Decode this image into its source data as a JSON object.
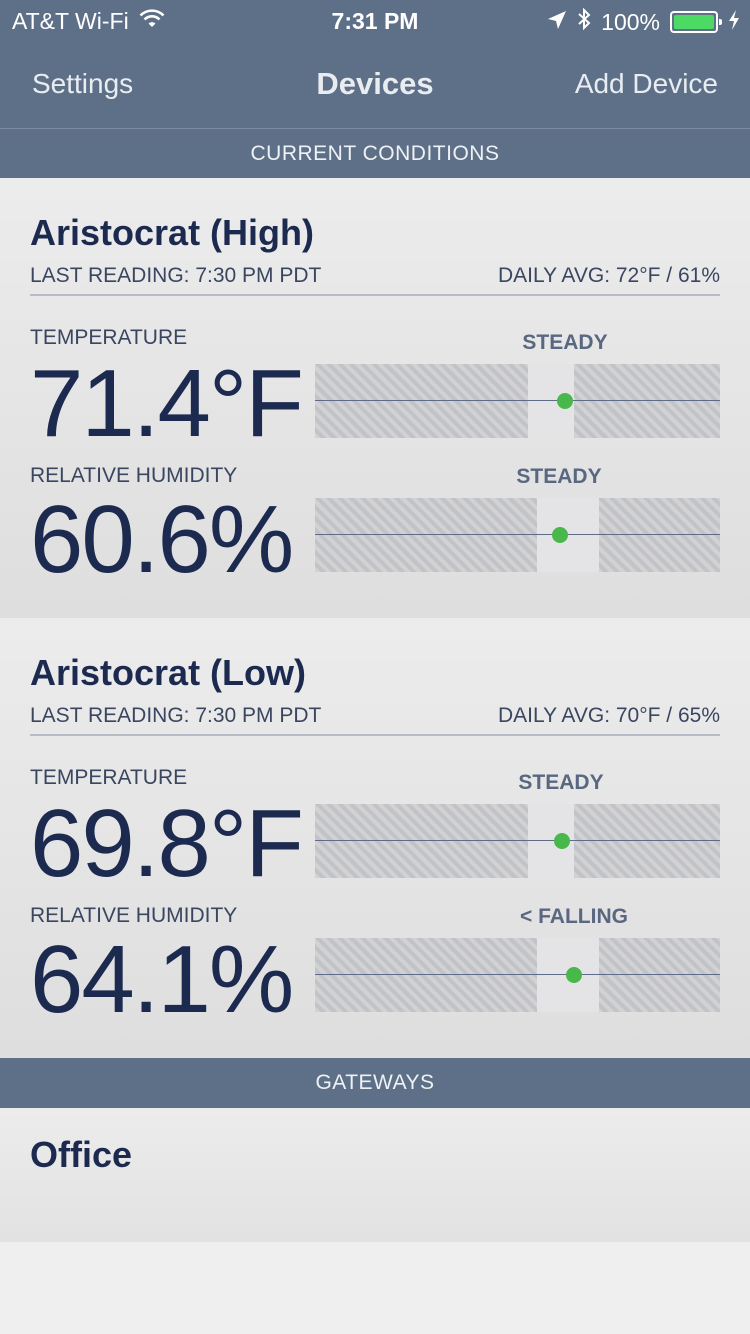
{
  "status_bar": {
    "carrier": "AT&T Wi-Fi",
    "time": "7:31 PM",
    "battery": "100%",
    "wifi_icon": "wifi-icon",
    "location_icon": "location-arrow-icon",
    "bluetooth_icon": "bluetooth-icon",
    "charging_icon": "bolt-icon"
  },
  "nav": {
    "left": "Settings",
    "title": "Devices",
    "right": "Add Device"
  },
  "sections": {
    "current": "CURRENT CONDITIONS",
    "gateways": "GATEWAYS"
  },
  "devices": [
    {
      "name": "Aristocrat (High)",
      "last_reading": "LAST READING: 7:30 PM PDT",
      "daily_avg": "DAILY AVG: 72°F / 61%",
      "temperature": {
        "label": "TEMPERATURE",
        "value": "71.4°F",
        "trend": "STEADY"
      },
      "humidity": {
        "label": "RELATIVE HUMIDITY",
        "value": "60.6%",
        "trend": "STEADY"
      }
    },
    {
      "name": "Aristocrat (Low)",
      "last_reading": "LAST READING: 7:30 PM PDT",
      "daily_avg": "DAILY AVG: 70°F / 65%",
      "temperature": {
        "label": "TEMPERATURE",
        "value": "69.8°F",
        "trend": "STEADY"
      },
      "humidity": {
        "label": "RELATIVE HUMIDITY",
        "value": "64.1%",
        "trend": "< FALLING"
      }
    }
  ],
  "gateways": [
    {
      "name": "Office"
    }
  ],
  "colors": {
    "bar": "#5e7088",
    "text_dark": "#1d2a50",
    "dot": "#49b84a"
  }
}
